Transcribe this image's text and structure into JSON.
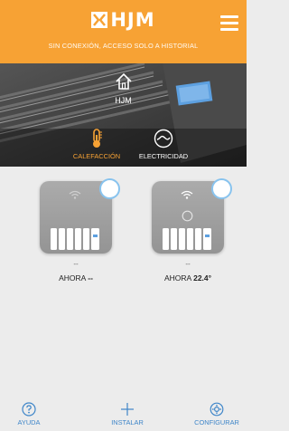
{
  "header": {
    "logo_text": "HJM",
    "status_text": "SIN CONEXIÓN, ACCESO SOLO A HISTORIAL",
    "menu_icon": "hamburger-menu-icon",
    "background_color": "#f7a234"
  },
  "home": {
    "icon": "home-icon",
    "name": "HJM"
  },
  "tabs": [
    {
      "label": "CALEFACCIÓN",
      "icon": "thermometer-icon",
      "active": true,
      "color": "#f7a234"
    },
    {
      "label": "ELECTRICIDAD",
      "icon": "energy-meter-icon",
      "active": false,
      "color": "#ffffff"
    }
  ],
  "devices": [
    {
      "dash": "--",
      "reading_label": "AHORA",
      "reading_value": "--",
      "icon": "radiator-icon",
      "wifi_icon": "wifi-icon",
      "power_icon": null
    },
    {
      "dash": "--",
      "reading_label": "AHORA",
      "reading_value": "22.4°",
      "icon": "radiator-icon",
      "wifi_icon": "wifi-icon",
      "power_icon": "power-icon"
    }
  ],
  "bottom_nav": [
    {
      "label": "AYUDA",
      "icon": "help-icon"
    },
    {
      "label": "INSTALAR",
      "icon": "plus-icon"
    },
    {
      "label": "CONFIGURAR",
      "icon": "settings-icon"
    }
  ],
  "accent_color": "#3f86c9"
}
